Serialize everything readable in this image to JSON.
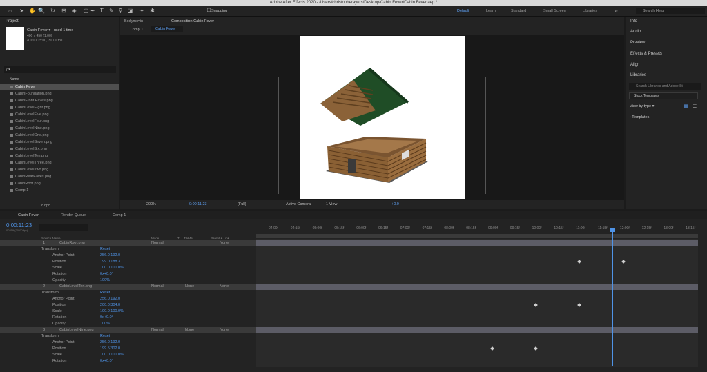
{
  "app": {
    "title": "Adobe After Effects 2020 - /Users/christopherayers/Desktop/Cabin Fever/Cabin Fever.aep *"
  },
  "toolbar": {
    "snapping": "Snapping",
    "workspaces": [
      "Default",
      "Learn",
      "Standard",
      "Small Screen",
      "Libraries"
    ],
    "search": "Search Help"
  },
  "project": {
    "panel_title": "Project",
    "comp_name": "Cabin Fever ▾ , used 1 time",
    "comp_size": "400 x 450 (1.00)",
    "comp_dur": "Δ 0:00:15:00, 30.00 fps",
    "search": "ρ▾",
    "name_header": "Name",
    "bpc": "8 bpc",
    "items": [
      "Cabin Fever",
      "CabinFoundation.png",
      "CabinFront Eaves.png",
      "CabinLevelEight.png",
      "CabinLevelFive.png",
      "CabinLevelFour.png",
      "CabinLevelNine.png",
      "CabinLevelOne.png",
      "CabinLevelSeven.png",
      "CabinLevelSix.png",
      "CabinLevelTen.png",
      "CabinLevelThree.png",
      "CabinLevelTwo.png",
      "CabinRearEaves.png",
      "CabinRoof.png",
      "Comp 1"
    ]
  },
  "viewer": {
    "tab_bodymovin": "Bodymovin",
    "tab_comp": "Composition Cabin Fever",
    "breadcrumb_comp1": "Comp 1",
    "breadcrumb_cabin": "Cabin Fever",
    "zoom": "200%",
    "time": "0:00:11:23",
    "quality": "(Full)",
    "camera": "Active Camera",
    "view": "1 View",
    "offset": "+0.0"
  },
  "right": {
    "items": [
      "Info",
      "Audio",
      "Preview",
      "Effects & Presets",
      "Align",
      "Libraries"
    ],
    "lib_search": "Search Libraries and Adobe St",
    "stock": "Stock Templates",
    "view_by": "View by type ▾",
    "templates": "Templates"
  },
  "timeline": {
    "tab_cabin": "Cabin Fever",
    "tab_render": "Render Queue",
    "tab_comp1": "Comp 1",
    "current_time": "0:00:11:23",
    "fps_line": "00359 (30.00 fps)",
    "headers": {
      "source": "Source Name",
      "mode": "Mode",
      "t": "T",
      "trkmat": "TrkMat",
      "parent": "Parent & Link"
    },
    "ticks": [
      "04:00f",
      "04:15f",
      "05:00f",
      "05:15f",
      "06:00f",
      "06:15f",
      "07:00f",
      "07:15f",
      "08:00f",
      "08:15f",
      "09:00f",
      "09:15f",
      "10:00f",
      "10:15f",
      "11:00f",
      "11:15f",
      "12:00f",
      "12:15f",
      "13:00f",
      "13:15f"
    ],
    "layers": [
      {
        "num": "1",
        "name": "CabinRoof.png",
        "mode": "Normal",
        "trk": "",
        "parent": "None",
        "transform": "Transform",
        "reset": "Reset",
        "anchor": "256.0,192.0",
        "position": "199.0,188.3",
        "scale": "100.0,100.0%",
        "rotation": "0x+0.0°",
        "opacity": "100%"
      },
      {
        "num": "2",
        "name": "CabinLevelTen.png",
        "mode": "Normal",
        "trk": "None",
        "parent": "None",
        "transform": "Transform",
        "reset": "Reset",
        "anchor": "256.0,192.0",
        "position": "200.0,304.0",
        "scale": "100.0,100.0%",
        "rotation": "0x+0.0°",
        "opacity": "100%"
      },
      {
        "num": "3",
        "name": "CabinLevelNine.png",
        "mode": "Normal",
        "trk": "None",
        "parent": "None",
        "transform": "Transform",
        "reset": "Reset",
        "anchor": "256.0,192.0",
        "position": "199.5,302.0",
        "scale": "100.0,100.0%",
        "rotation": "0x+0.0°"
      }
    ],
    "labels": {
      "anchor": "Anchor Point",
      "position": "Position",
      "scale": "Scale",
      "rotation": "Rotation",
      "opacity": "Opacity"
    }
  }
}
